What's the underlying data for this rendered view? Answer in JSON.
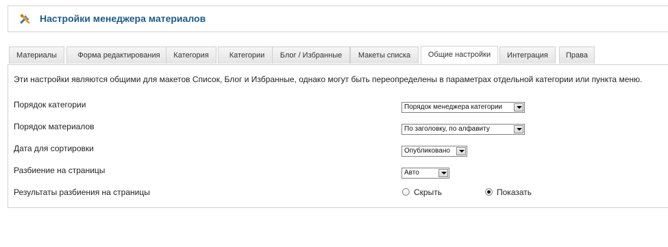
{
  "header": {
    "title": "Настройки менеджера материалов",
    "icon": "tools-icon"
  },
  "tabs": [
    {
      "label": "Материалы",
      "active": false
    },
    {
      "label": "Форма редактирования",
      "active": false
    },
    {
      "label": "Категория",
      "active": false
    },
    {
      "label": "Категории",
      "active": false
    },
    {
      "label": "Блог / Избранные",
      "active": false
    },
    {
      "label": "Макеты списка",
      "active": false
    },
    {
      "label": "Общие настройки",
      "active": true
    },
    {
      "label": "Интеграция",
      "active": false
    },
    {
      "label": "Права",
      "active": false
    }
  ],
  "panel": {
    "description": "Эти настройки являются общими для макетов Список, Блог и Избранные, однако могут быть переопределены в параметрах отдельной категории или пункта меню.",
    "fields": {
      "category_order": {
        "label": "Порядок категории",
        "value": "Порядок менеджера категории"
      },
      "article_order": {
        "label": "Порядок материалов",
        "value": "По заголовку, по алфавиту"
      },
      "sort_date": {
        "label": "Дата для сортировки",
        "value": "Опубликовано"
      },
      "pagination": {
        "label": "Разбиение на страницы",
        "value": "Авто"
      },
      "pagination_results": {
        "label": "Результаты разбиения на страницы",
        "options": [
          {
            "label": "Скрыть",
            "checked": false
          },
          {
            "label": "Показать",
            "checked": true
          }
        ]
      }
    }
  },
  "colors": {
    "title": "#1b5a8a",
    "border": "#cfcfcf"
  }
}
